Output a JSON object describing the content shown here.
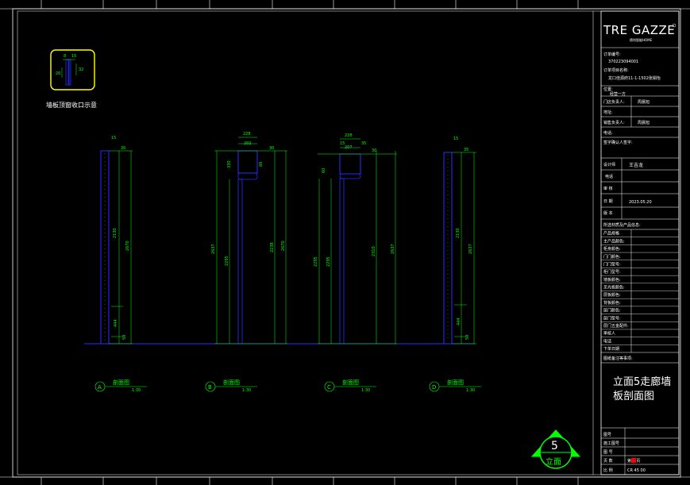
{
  "colors": {
    "background": "#000000",
    "frame": "#ffffff",
    "dimension": "#00ff00",
    "panel": "#2b2bff",
    "highlight": "#ffff00",
    "accent_red": "#ff0000"
  },
  "title_block": {
    "logo": "TRE GAZZE",
    "logo_sub": "德利智能HOME",
    "order_no_label": "订单编号:",
    "order_no": "370223094001",
    "project_label": "订单项目名称:",
    "project": "龙口佳源府11-1-1502张娟怡",
    "location_label": "位置:",
    "client_label": "经营一方",
    "store_label": "门店负责人:",
    "store_value": "周晨旭",
    "address_label": "地址:",
    "sales_label": "销售负责人:",
    "sales_value": "周晨旭",
    "phone_label": "电话:",
    "signature_label": "签字确认人签字:",
    "designer_label": "设计师",
    "designer": "王吉龙",
    "phone2_label": "电话",
    "review_label": "审 核",
    "date_label": "日 期",
    "date": "2023.05.20",
    "version_label": "版 本",
    "materials_header": "所选材质及产品信息:",
    "material_labels": [
      "产品规格",
      "主产品颜色:",
      "柜身颜色:",
      "门门颜色:",
      "门门型号:",
      "柜门型号:",
      "墙板颜色:",
      "见光板颜色:",
      "层板颜色:",
      "背板颜色:",
      "层门颜色:",
      "层门型号:",
      "层门五金配件:",
      "审核人",
      "电话",
      "下单日期"
    ],
    "remarks_label": "图纸备注等事项:",
    "drawing_title_line1": "立面5走廊墙",
    "drawing_title_line2": "板剖面图",
    "bottom_labels": [
      "图号",
      "施工图号",
      "图 号",
      "第 页 共 页",
      "页 数"
    ],
    "scale_label": "比 例",
    "scale_value": "CR 45 00",
    "sheet": "第15页"
  },
  "detail": {
    "caption": "墙板顶窗收口示意",
    "dims": [
      "8",
      "15",
      "20",
      "32"
    ]
  },
  "sections": [
    {
      "letter": "A",
      "title": "剖面图",
      "scale": "1:30"
    },
    {
      "letter": "B",
      "title": "剖面图",
      "scale": "1:30"
    },
    {
      "letter": "C",
      "title": "剖面图",
      "scale": "1:30"
    },
    {
      "letter": "D",
      "title": "剖面图",
      "scale": "1:30"
    }
  ],
  "dims_a": [
    "15",
    "30",
    "2130",
    "2670",
    "444",
    "50"
  ],
  "dims_b": [
    "228",
    "202",
    "30",
    "330",
    "60",
    "2637",
    "2295",
    "2238",
    "2670"
  ],
  "dims_c": [
    "228",
    "207",
    "15",
    "35",
    "30",
    "60",
    "2295",
    "2295",
    "2310",
    "2637"
  ],
  "dims_d": [
    "15",
    "35",
    "2130",
    "2637",
    "444",
    "50"
  ],
  "elevation_marker": {
    "number": "5",
    "label": "立面"
  }
}
